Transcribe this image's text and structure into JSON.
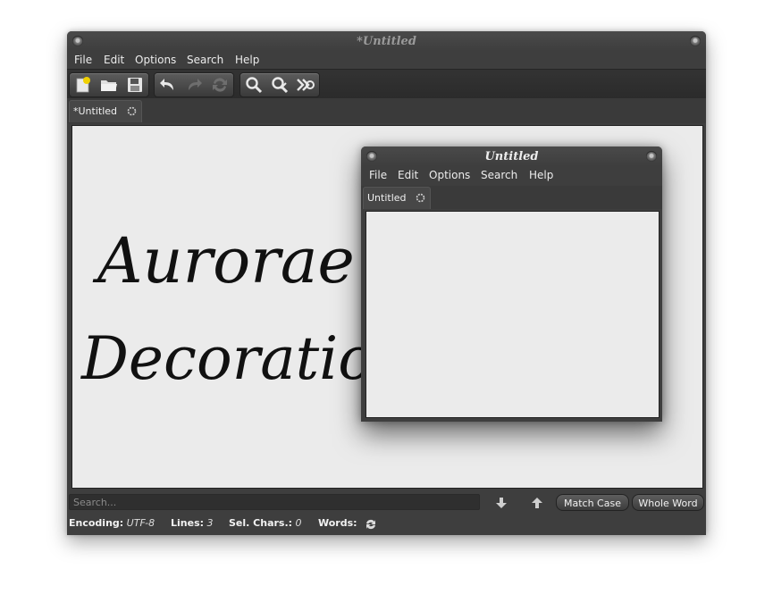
{
  "main_window": {
    "title": "*Untitled",
    "menu": [
      "File",
      "Edit",
      "Options",
      "Search",
      "Help"
    ],
    "toolbar_icons": {
      "file_group": [
        "new-document-icon",
        "open-folder-icon",
        "save-icon"
      ],
      "edit_group": [
        "undo-icon",
        "redo-icon",
        "reload-icon"
      ],
      "search_group": [
        "find-icon",
        "find-replace-icon",
        "jump-icon"
      ]
    },
    "tab": {
      "label": "*Untitled",
      "icon": "close-tab-icon"
    },
    "editor": {
      "line1": "Aurorae",
      "line2": "Decoration"
    },
    "search": {
      "placeholder": "Search...",
      "value": "",
      "next_icon": "arrow-down-icon",
      "prev_icon": "arrow-up-icon",
      "match_case_label": "Match Case",
      "whole_word_label": "Whole Word"
    },
    "status": {
      "encoding_label": "Encoding:",
      "encoding_value": "UTF-8",
      "lines_label": "Lines:",
      "lines_value": "3",
      "sel_label": "Sel. Chars.:",
      "sel_value": "0",
      "words_label": "Words:",
      "words_icon": "refresh-icon"
    }
  },
  "preview_window": {
    "title": "Untitled",
    "menu": [
      "File",
      "Edit",
      "Options",
      "Search",
      "Help"
    ],
    "tab": {
      "label": "Untitled",
      "icon": "close-tab-icon"
    }
  },
  "colors": {
    "frame": "#3e3e3e",
    "editor_bg": "#ebebeb",
    "text_light": "#e8e8e8",
    "title_inactive": "#9a9a9a",
    "new_doc_star": "#f0d000"
  }
}
